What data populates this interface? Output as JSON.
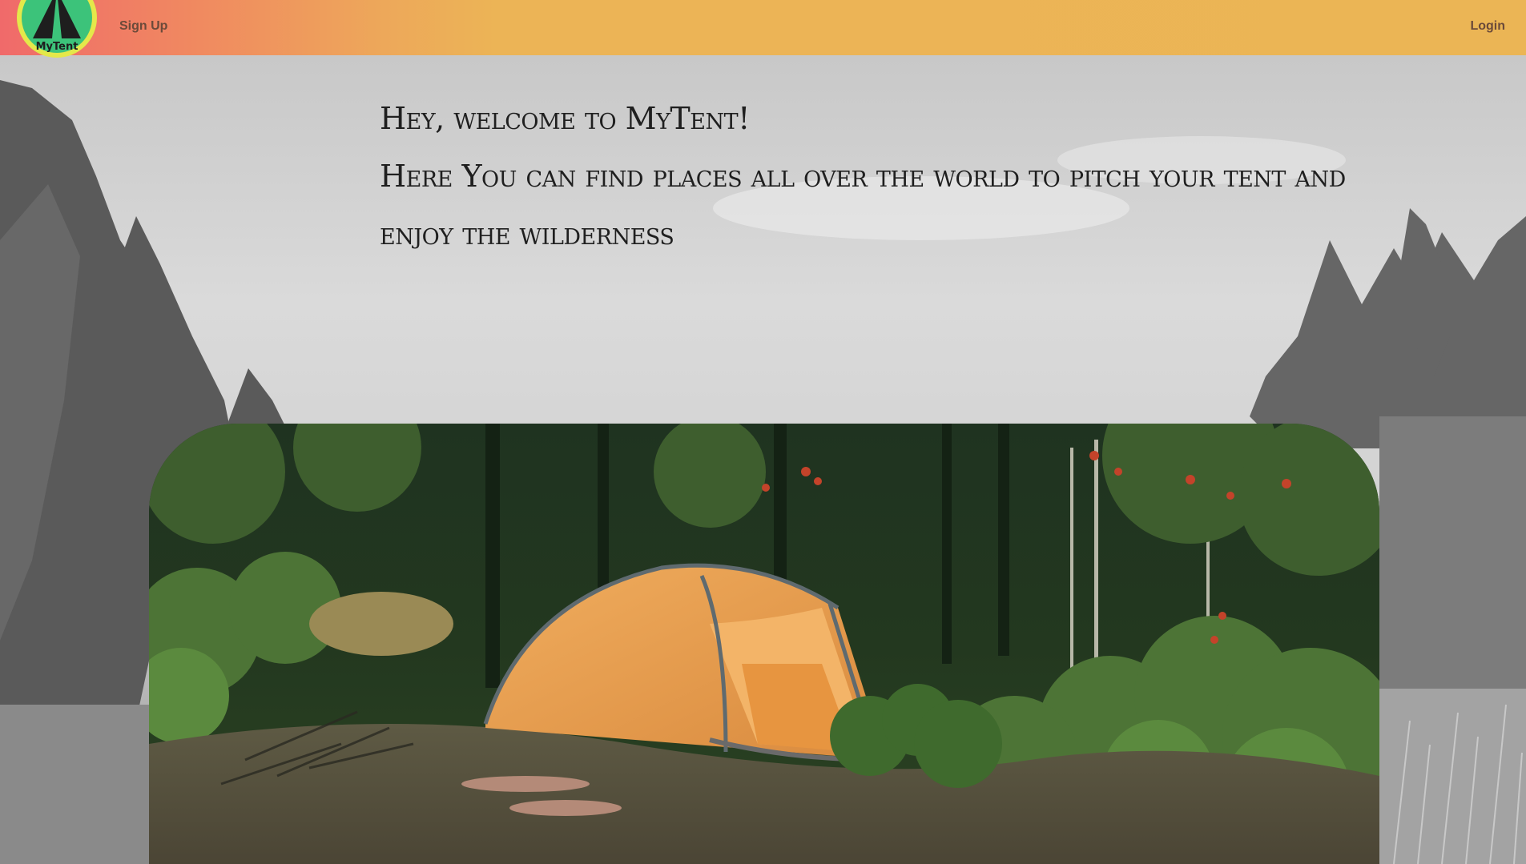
{
  "brand": {
    "name": "MyTent"
  },
  "nav": {
    "signup_label": "Sign Up",
    "login_label": "Login"
  },
  "hero": {
    "welcome_line1": "Hey, welcome to MyTent!",
    "welcome_line2": "Here You can find places all over the world to pitch your tent and",
    "welcome_line3": "enjoy the wilderness"
  },
  "colors": {
    "navbar_start": "#f06a6a",
    "navbar_end": "#ebb555",
    "logo_ring": "#e4e84a",
    "logo_fill": "#3cc37a",
    "tent_orange": "#e89a45"
  },
  "icons": {
    "logo": "tent-logo-icon"
  }
}
